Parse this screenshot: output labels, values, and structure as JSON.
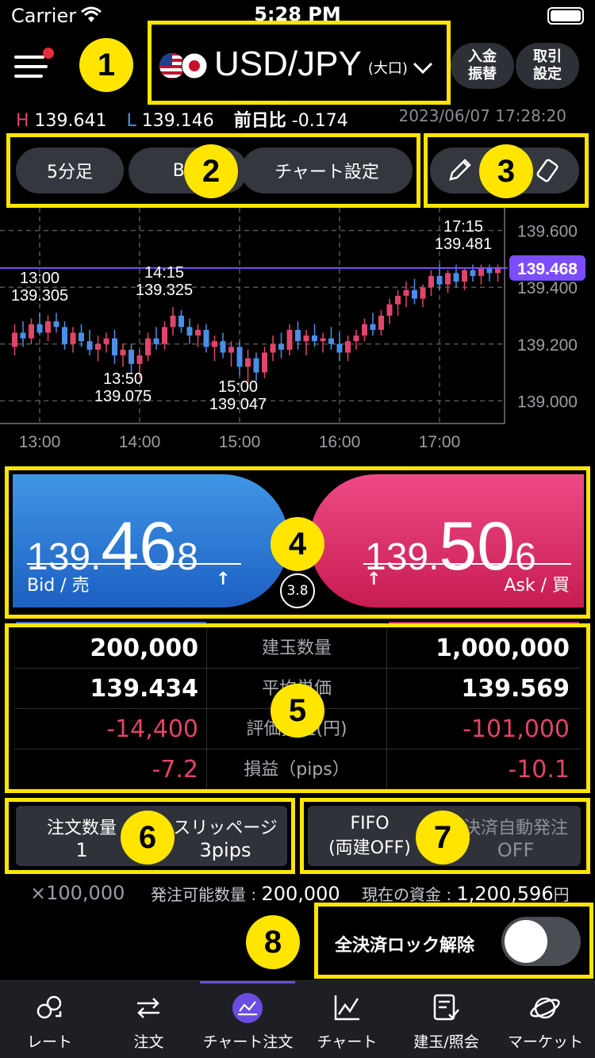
{
  "status_bar": {
    "carrier": "Carrier",
    "time": "5:28 PM"
  },
  "header": {
    "pair": "USD/JPY",
    "pair_sub": "(大口)",
    "deposit_btn": "入金\n振替",
    "trade_settings_btn": "取引\n設定"
  },
  "quote": {
    "high_label": "H",
    "high": "139.641",
    "low_label": "L",
    "low": "139.146",
    "change_label": "前日比",
    "change": "-0.174",
    "timestamp": "2023/06/07 17:28:20"
  },
  "toolbar": {
    "timeframe": "5分足",
    "price_type": "BID",
    "chart_settings": "チャート設定"
  },
  "chart_data": {
    "type": "candlestick",
    "x_ticks": [
      "13:00",
      "14:00",
      "15:00",
      "16:00",
      "17:00"
    ],
    "y_ticks": [
      "139.600",
      "139.400",
      "139.200",
      "139.000"
    ],
    "y_range": [
      138.92,
      139.68
    ],
    "current_price": "139.468",
    "annotations": [
      {
        "time": "13:00",
        "value": "139.305",
        "label": "13:00\n139.305"
      },
      {
        "time": "14:15",
        "value": "139.325",
        "label": "14:15\n139.325"
      },
      {
        "time": "13:50",
        "value": "139.075",
        "label": "13:50\n139.075"
      },
      {
        "time": "15:00",
        "value": "139.047",
        "label": "15:00\n139.047"
      },
      {
        "time": "17:15",
        "value": "139.481",
        "label": "17:15\n139.481"
      }
    ],
    "candles": [
      [
        139.19,
        139.27,
        139.16,
        139.24
      ],
      [
        139.24,
        139.28,
        139.19,
        139.22
      ],
      [
        139.22,
        139.29,
        139.2,
        139.27
      ],
      [
        139.27,
        139.31,
        139.23,
        139.24
      ],
      [
        139.24,
        139.3,
        139.21,
        139.28
      ],
      [
        139.28,
        139.31,
        139.24,
        139.26
      ],
      [
        139.26,
        139.28,
        139.18,
        139.2
      ],
      [
        139.2,
        139.26,
        139.17,
        139.24
      ],
      [
        139.24,
        139.27,
        139.19,
        139.21
      ],
      [
        139.21,
        139.25,
        139.16,
        139.18
      ],
      [
        139.18,
        139.23,
        139.14,
        139.2
      ],
      [
        139.2,
        139.24,
        139.17,
        139.22
      ],
      [
        139.22,
        139.25,
        139.13,
        139.16
      ],
      [
        139.16,
        139.2,
        139.12,
        139.18
      ],
      [
        139.18,
        139.2,
        139.1,
        139.13
      ],
      [
        139.13,
        139.18,
        139.08,
        139.16
      ],
      [
        139.16,
        139.24,
        139.14,
        139.22
      ],
      [
        139.22,
        139.26,
        139.18,
        139.2
      ],
      [
        139.2,
        139.28,
        139.18,
        139.26
      ],
      [
        139.26,
        139.33,
        139.23,
        139.3
      ],
      [
        139.3,
        139.32,
        139.24,
        139.26
      ],
      [
        139.26,
        139.29,
        139.2,
        139.23
      ],
      [
        139.23,
        139.27,
        139.19,
        139.25
      ],
      [
        139.25,
        139.27,
        139.17,
        139.19
      ],
      [
        139.19,
        139.23,
        139.14,
        139.21
      ],
      [
        139.21,
        139.24,
        139.15,
        139.17
      ],
      [
        139.17,
        139.21,
        139.12,
        139.19
      ],
      [
        139.19,
        139.21,
        139.09,
        139.12
      ],
      [
        139.12,
        139.18,
        139.05,
        139.15
      ],
      [
        139.15,
        139.17,
        139.07,
        139.1
      ],
      [
        139.1,
        139.19,
        139.08,
        139.17
      ],
      [
        139.17,
        139.23,
        139.14,
        139.2
      ],
      [
        139.2,
        139.24,
        139.15,
        139.18
      ],
      [
        139.18,
        139.27,
        139.16,
        139.25
      ],
      [
        139.25,
        139.28,
        139.18,
        139.21
      ],
      [
        139.21,
        139.25,
        139.16,
        139.23
      ],
      [
        139.23,
        139.27,
        139.19,
        139.21
      ],
      [
        139.21,
        139.24,
        139.17,
        139.22
      ],
      [
        139.22,
        139.26,
        139.18,
        139.2
      ],
      [
        139.2,
        139.24,
        139.14,
        139.17
      ],
      [
        139.17,
        139.23,
        139.14,
        139.21
      ],
      [
        139.21,
        139.25,
        139.18,
        139.23
      ],
      [
        139.23,
        139.29,
        139.21,
        139.27
      ],
      [
        139.27,
        139.31,
        139.23,
        139.25
      ],
      [
        139.25,
        139.32,
        139.23,
        139.3
      ],
      [
        139.3,
        139.36,
        139.27,
        139.34
      ],
      [
        139.34,
        139.39,
        139.3,
        139.37
      ],
      [
        139.37,
        139.42,
        139.33,
        139.39
      ],
      [
        139.39,
        139.43,
        139.34,
        139.36
      ],
      [
        139.36,
        139.41,
        139.33,
        139.4
      ],
      [
        139.4,
        139.46,
        139.37,
        139.44
      ],
      [
        139.44,
        139.48,
        139.39,
        139.41
      ],
      [
        139.41,
        139.46,
        139.38,
        139.45
      ],
      [
        139.45,
        139.48,
        139.4,
        139.42
      ],
      [
        139.42,
        139.47,
        139.39,
        139.46
      ],
      [
        139.46,
        139.48,
        139.42,
        139.44
      ],
      [
        139.44,
        139.48,
        139.41,
        139.47
      ],
      [
        139.47,
        139.48,
        139.42,
        139.45
      ],
      [
        139.45,
        139.48,
        139.42,
        139.47
      ]
    ],
    "colors": {
      "up": "#e0456b",
      "down": "#4a8ee8",
      "price_line": "#7c4dff"
    }
  },
  "trade": {
    "bid": {
      "p1": "139.",
      "p2": "46",
      "p3": "8",
      "label": "Bid / 売",
      "arrow": "↑"
    },
    "ask": {
      "p1": "139.",
      "p2": "50",
      "p3": "6",
      "label": "Ask / 買",
      "arrow": "↑"
    },
    "spread": "3.8"
  },
  "positions": {
    "rows": [
      {
        "left": "200,000",
        "label": "建玉数量",
        "right": "1,000,000",
        "neg": false
      },
      {
        "left": "139.434",
        "label": "平均単価",
        "right": "139.569",
        "neg": false
      },
      {
        "left": "-14,400",
        "label": "評価損益(円)",
        "right": "-101,000",
        "neg": true
      },
      {
        "left": "-7.2",
        "label": "損益（pips）",
        "right": "-10.1",
        "neg": true
      }
    ]
  },
  "order": {
    "qty_label": "注文数量",
    "qty": "1",
    "slip_label": "スリッページ",
    "slip": "3pips",
    "fifo_label": "FIFO",
    "fifo_value": "(両建OFF)",
    "auto_label": "決済自動発注",
    "auto_value": "OFF"
  },
  "account": {
    "unit": "×100,000",
    "orderable_label": "発注可能数量 : ",
    "orderable": "200,000",
    "funds_label": "現在の資金 : ",
    "funds": "1,200,596",
    "funds_unit": "円"
  },
  "lock": {
    "label": "全決済ロック解除"
  },
  "markers": [
    "1",
    "2",
    "3",
    "4",
    "5",
    "6",
    "7",
    "8"
  ],
  "tabs": [
    {
      "label": "レート",
      "icon": "rate-icon"
    },
    {
      "label": "注文",
      "icon": "order-icon"
    },
    {
      "label": "チャート注文",
      "icon": "chart-order-icon"
    },
    {
      "label": "チャート",
      "icon": "chart-icon"
    },
    {
      "label": "建玉/照会",
      "icon": "position-icon"
    },
    {
      "label": "マーケット",
      "icon": "market-icon"
    }
  ]
}
